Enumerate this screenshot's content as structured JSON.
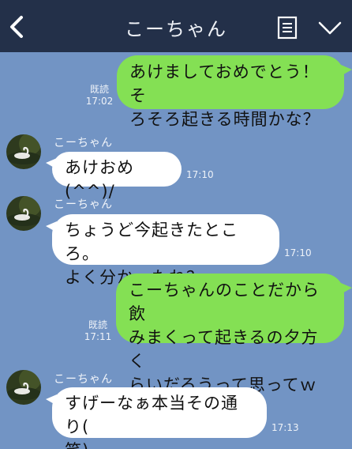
{
  "header": {
    "title": "こーちゃん",
    "bg_color": "#233049"
  },
  "icons": {
    "back": "chevron-left-icon",
    "menu": "notes-icon",
    "more": "chevron-down-icon"
  },
  "messages": [
    {
      "side": "out",
      "text1": "あけましておめでとう！そ",
      "text2": "ろそろ起きる時間かな？",
      "read": "既読",
      "time": "17:02"
    },
    {
      "side": "in",
      "sender": "こーちゃん",
      "text1": "あけおめ(^^)/",
      "time": "17:10"
    },
    {
      "side": "in",
      "sender": "こーちゃん",
      "text1": "ちょうど今起きたところ。",
      "text2": "よく分かったね？",
      "time": "17:10"
    },
    {
      "side": "out",
      "text1": "こーちゃんのことだから飲",
      "text2": "みまくって起きるの夕方く",
      "text3": "らいだろうって思ってｗ",
      "read": "既読",
      "time": "17:11"
    },
    {
      "side": "in",
      "sender": "こーちゃん",
      "text1": "すげーなぁ本当その通り(",
      "text2": "笑)",
      "time": "17:13"
    }
  ],
  "colors": {
    "background": "#7294c4",
    "outgoing_bubble": "#84e054",
    "incoming_bubble": "#ffffff"
  }
}
